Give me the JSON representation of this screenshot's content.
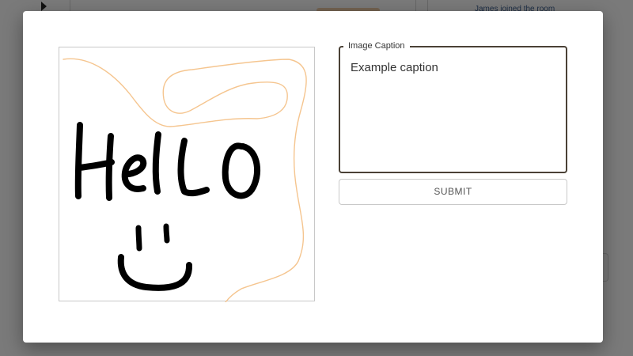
{
  "background": {
    "status_text": "James joined the room"
  },
  "modal": {
    "drawing": {
      "text": "Hello",
      "stroke_color": "#000000",
      "guide_color": "#f5c58f"
    },
    "caption": {
      "legend": "Image Caption",
      "value": "Example caption"
    },
    "submit_label": "SUBMIT"
  },
  "colors": {
    "overlay": "rgba(0,0,0,0.5)",
    "field_border": "#4a4136",
    "button_border": "#c9c9c9"
  }
}
